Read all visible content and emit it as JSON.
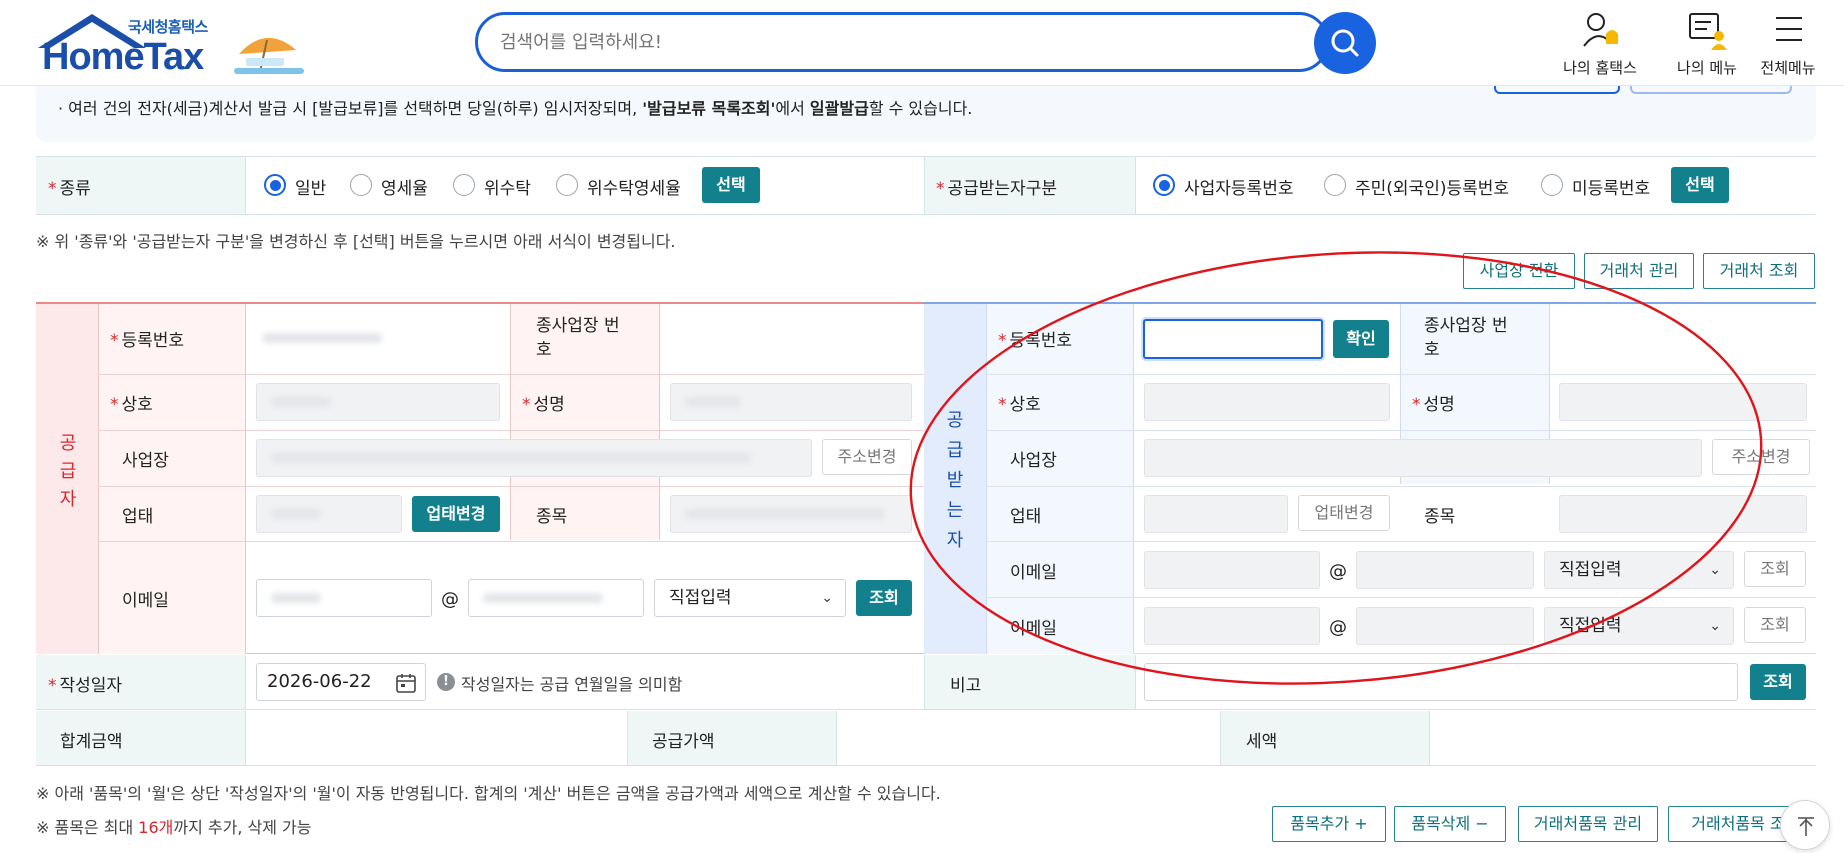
{
  "header": {
    "logo_sub": "국세청홈택스",
    "logo_main": "HomeTax",
    "search_placeholder": "검색어를 입력하세요!",
    "menu": [
      {
        "label": "나의 홈택스",
        "icon": "user-bell-icon"
      },
      {
        "label": "나의 메뉴",
        "icon": "user-list-icon"
      },
      {
        "label": "전체메뉴",
        "icon": "hamburger-icon"
      }
    ]
  },
  "notice": {
    "prefix": "· 여러 건의 전자(세금)계산서 발급 시 [발급보류]를 선택하면 당일(하루) 임시저장되며, ",
    "bold1": "'발급보류 목록조회'",
    "mid": "에서 ",
    "bold2": "일괄발급",
    "suffix": "할 수 있습니다."
  },
  "type_row": {
    "label": "종류",
    "options": [
      "일반",
      "영세율",
      "위수탁",
      "위수탁영세율"
    ],
    "selected": "일반",
    "select_button": "선택",
    "recipient_label": "공급받는자구분",
    "recipient_options": [
      "사업자등록번호",
      "주민(외국인)등록번호",
      "미등록번호"
    ],
    "recipient_selected": "사업자등록번호",
    "recipient_select_button": "선택"
  },
  "type_note": "※ 위 '종류'와 '공급받는자 구분'을 변경하신 후 [선택] 버튼을 누르시면 아래 서식이 변경됩니다.",
  "action_buttons": [
    "사업장 전환",
    "거래처 관리",
    "거래처 조회"
  ],
  "supplier": {
    "section_label": "공급자",
    "reg_no_label": "등록번호",
    "sub_branch_label": "종사업장 번호",
    "company_label": "상호",
    "name_label": "성명",
    "address_label": "사업장",
    "address_change": "주소변경",
    "biz_type_label": "업태",
    "biz_type_change": "업태변경",
    "item_label": "종목",
    "email_label": "이메일",
    "email_at": "@",
    "email_domain_select": "직접입력",
    "lookup_button": "조회"
  },
  "recipient": {
    "section_label": "공급받는자",
    "reg_no_label": "등록번호",
    "confirm_button": "확인",
    "sub_branch_label": "종사업장 번호",
    "company_label": "상호",
    "name_label": "성명",
    "address_label": "사업장",
    "address_change": "주소변경",
    "biz_type_label": "업태",
    "biz_type_change": "업태변경",
    "item_label": "종목",
    "email_label": "이메일",
    "email_label_2": "이메일",
    "email_at": "@",
    "email_domain_select": "직접입력",
    "lookup_button": "조회"
  },
  "date_row": {
    "label": "작성일자",
    "value": "2026-06-22",
    "hint": "작성일자는 공급 연월일을 의미함",
    "remark_label": "비고",
    "remark_button": "조회"
  },
  "amount_row": {
    "total_label": "합계금액",
    "supply_label": "공급가액",
    "tax_label": "세액"
  },
  "notes": {
    "line1": "※ 아래 '품목'의 '월'은 상단 '작성일자'의 '월'이 자동 반영됩니다. 합계의 '계산' 버튼은 금액을 공급가액과 세액으로 계산할 수 있습니다.",
    "line2_prefix": "※ 품목은 최대 ",
    "line2_highlight": "16개",
    "line2_suffix": "까지 추가, 삭제 가능"
  },
  "item_buttons": [
    "품목추가 +",
    "품목삭제 −",
    "거래처품목 관리",
    "거래처품목 조"
  ],
  "colors": {
    "accent_blue": "#1a63e0",
    "teal": "#13808e",
    "supplier_red": "#d9262b",
    "annotation_red": "#e0141b"
  }
}
